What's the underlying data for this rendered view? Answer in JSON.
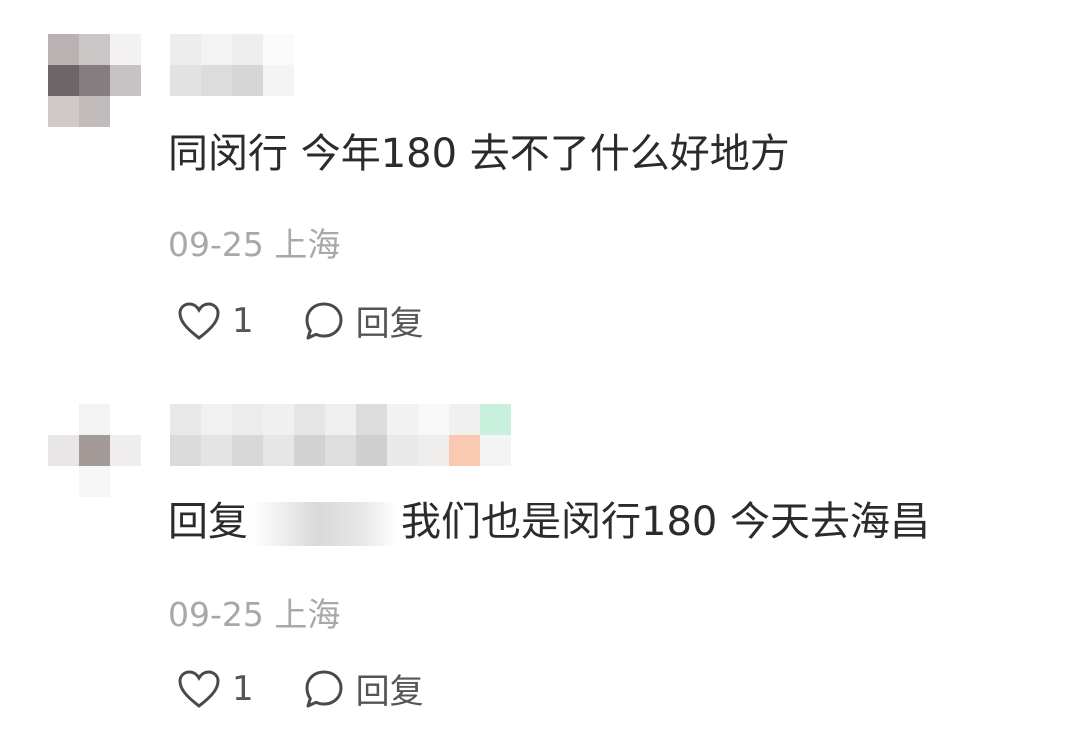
{
  "comments": [
    {
      "text": "同闵行 今年180 去不了什么好地方",
      "date": "09-25",
      "location": "上海",
      "like_count": "1",
      "reply_label": "回复"
    },
    {
      "reply_prefix": "回复",
      "text": "我们也是闵行180 今天去海昌",
      "date": "09-25",
      "location": "上海",
      "like_count": "1",
      "reply_label": "回复"
    }
  ],
  "icons": {
    "like": "heart-outline-icon",
    "reply": "speech-bubble-icon"
  },
  "colors": {
    "text": "#2b2b2b",
    "meta": "#a8a8a8",
    "background": "#ffffff"
  }
}
